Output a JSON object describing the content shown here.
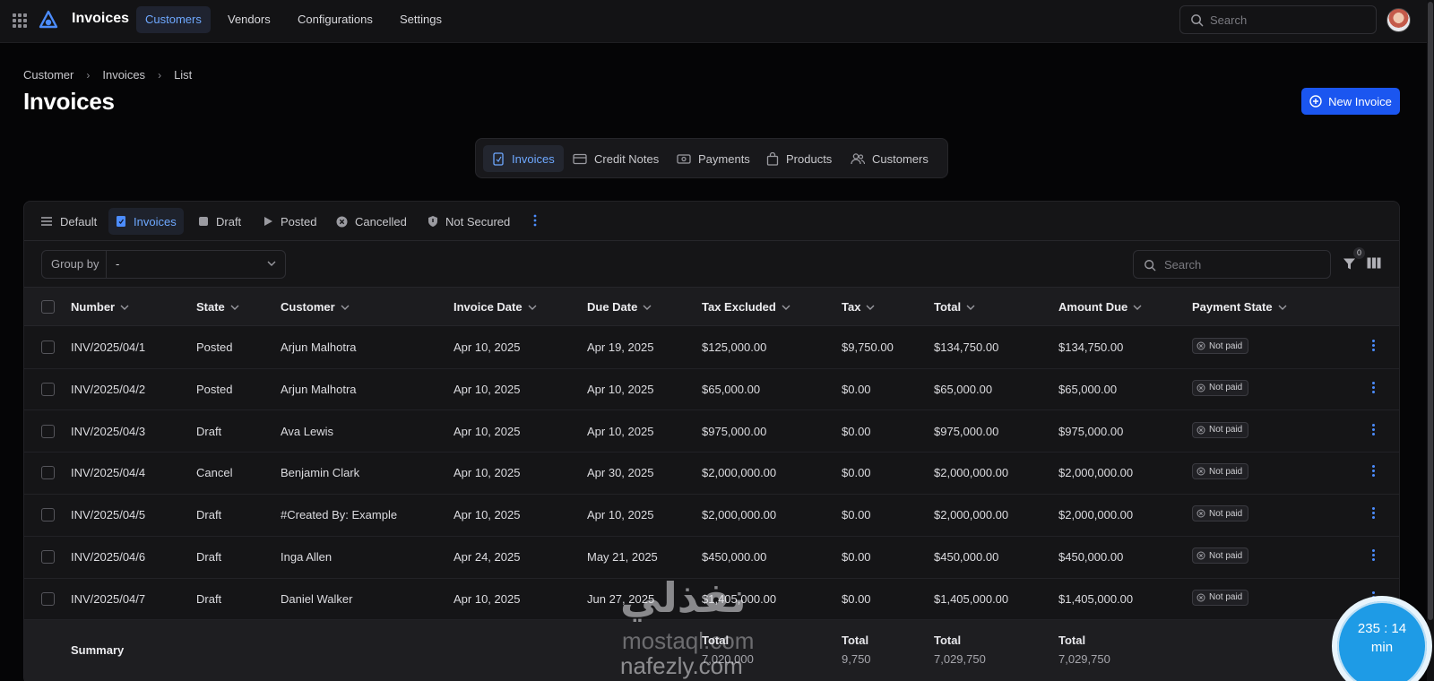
{
  "topbar": {
    "app_title": "Invoices",
    "nav": [
      "Customers",
      "Vendors",
      "Configurations",
      "Settings"
    ],
    "search_placeholder": "Search"
  },
  "breadcrumb": [
    "Customer",
    "Invoices",
    "List"
  ],
  "page_title": "Invoices",
  "new_button": "New Invoice",
  "module_tabs": [
    "Invoices",
    "Credit Notes",
    "Payments",
    "Products",
    "Customers"
  ],
  "filter_tabs": [
    "Default",
    "Invoices",
    "Draft",
    "Posted",
    "Cancelled",
    "Not Secured"
  ],
  "group_by": {
    "label": "Group by",
    "value": "-"
  },
  "table_search_placeholder": "Search",
  "filter_count": "0",
  "columns": [
    "Number",
    "State",
    "Customer",
    "Invoice Date",
    "Due Date",
    "Tax Excluded",
    "Tax",
    "Total",
    "Amount Due",
    "Payment State"
  ],
  "rows": [
    [
      "INV/2025/04/1",
      "Posted",
      "Arjun Malhotra",
      "Apr 10, 2025",
      "Apr 19, 2025",
      "$125,000.00",
      "$9,750.00",
      "$134,750.00",
      "$134,750.00",
      "Not paid"
    ],
    [
      "INV/2025/04/2",
      "Posted",
      "Arjun Malhotra",
      "Apr 10, 2025",
      "Apr 10, 2025",
      "$65,000.00",
      "$0.00",
      "$65,000.00",
      "$65,000.00",
      "Not paid"
    ],
    [
      "INV/2025/04/3",
      "Draft",
      "Ava Lewis",
      "Apr 10, 2025",
      "Apr 10, 2025",
      "$975,000.00",
      "$0.00",
      "$975,000.00",
      "$975,000.00",
      "Not paid"
    ],
    [
      "INV/2025/04/4",
      "Cancel",
      "Benjamin Clark",
      "Apr 10, 2025",
      "Apr 30, 2025",
      "$2,000,000.00",
      "$0.00",
      "$2,000,000.00",
      "$2,000,000.00",
      "Not paid"
    ],
    [
      "INV/2025/04/5",
      "Draft",
      "#Created By: Example",
      "Apr 10, 2025",
      "Apr 10, 2025",
      "$2,000,000.00",
      "$0.00",
      "$2,000,000.00",
      "$2,000,000.00",
      "Not paid"
    ],
    [
      "INV/2025/04/6",
      "Draft",
      "Inga Allen",
      "Apr 24, 2025",
      "May 21, 2025",
      "$450,000.00",
      "$0.00",
      "$450,000.00",
      "$450,000.00",
      "Not paid"
    ],
    [
      "INV/2025/04/7",
      "Draft",
      "Daniel Walker",
      "Apr 10, 2025",
      "Jun 27, 2025",
      "$1,405,000.00",
      "$0.00",
      "$1,405,000.00",
      "$1,405,000.00",
      "Not paid"
    ]
  ],
  "summary": {
    "label": "Summary",
    "totals": [
      {
        "label": "Total",
        "value": "7,020,000"
      },
      {
        "label": "Total",
        "value": "9,750"
      },
      {
        "label": "Total",
        "value": "7,029,750"
      },
      {
        "label": "Total",
        "value": "7,029,750"
      }
    ]
  },
  "watermark": {
    "arabic": "نفذلي",
    "line1": "mostaql.com",
    "line2": "nafezly.com"
  },
  "timer": {
    "time": "235 : 14",
    "unit": "min"
  },
  "colors": {
    "accent": "#1b56f0",
    "active_text": "#6ea8ff",
    "background": "#050506"
  }
}
